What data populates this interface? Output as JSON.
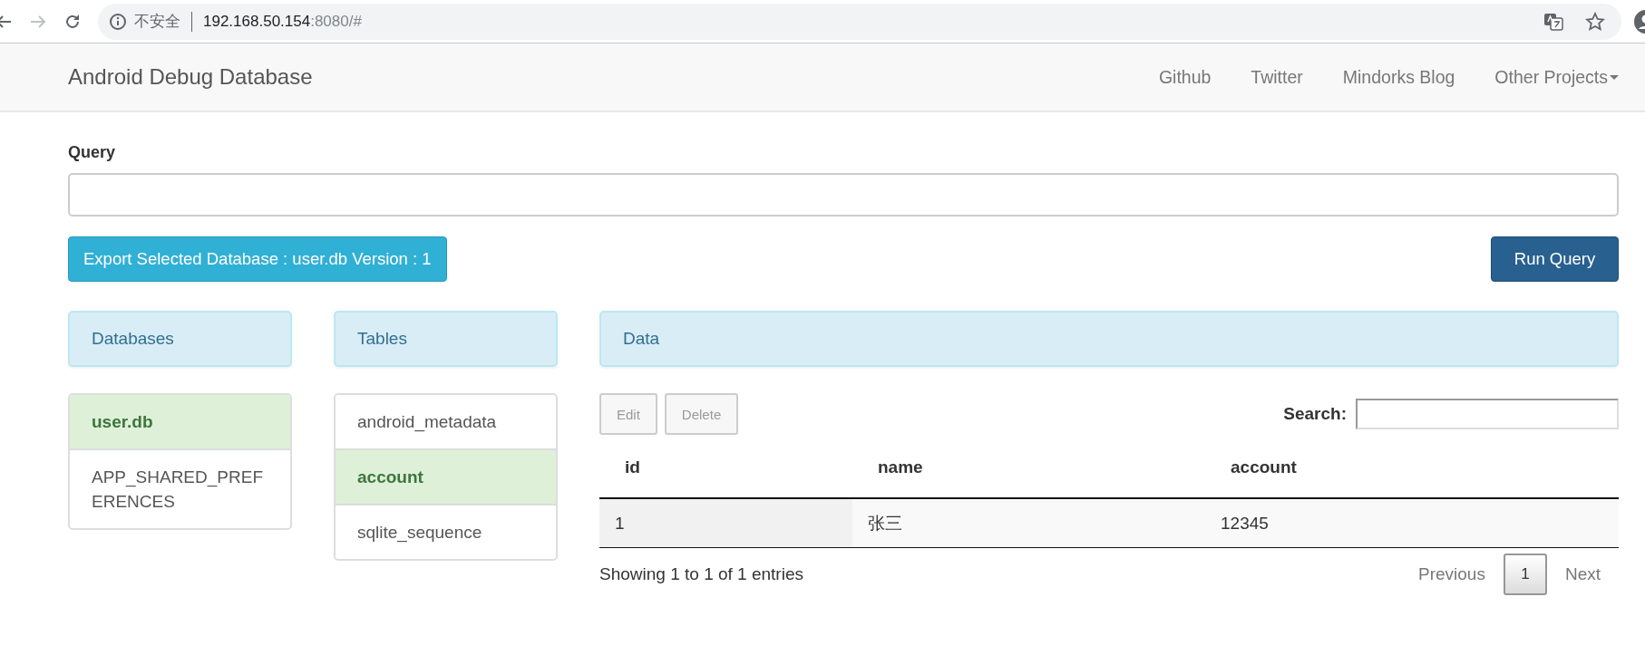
{
  "browser": {
    "security_label": "不安全",
    "url_host": "192.168.50.154",
    "url_rest": ":8080/#"
  },
  "navbar": {
    "brand": "Android Debug Database",
    "links": [
      {
        "label": "Github",
        "dropdown": false
      },
      {
        "label": "Twitter",
        "dropdown": false
      },
      {
        "label": "Mindorks Blog",
        "dropdown": false
      },
      {
        "label": "Other Projects",
        "dropdown": true
      }
    ]
  },
  "query": {
    "label": "Query"
  },
  "export_button": "Export Selected Database : user.db Version : 1",
  "run_button": "Run Query",
  "databases": {
    "heading": "Databases",
    "items": [
      {
        "label": "user.db",
        "selected": true
      },
      {
        "label": "APP_SHARED_PREFERENCES",
        "selected": false
      }
    ]
  },
  "tables": {
    "heading": "Tables",
    "items": [
      {
        "label": "android_metadata",
        "selected": false
      },
      {
        "label": "account",
        "selected": true
      },
      {
        "label": "sqlite_sequence",
        "selected": false
      }
    ]
  },
  "data": {
    "heading": "Data",
    "actions": [
      {
        "label": "Edit",
        "disabled": true
      },
      {
        "label": "Delete",
        "disabled": true
      }
    ],
    "search_label": "Search:",
    "columns": [
      "id",
      "name",
      "account"
    ],
    "rows": [
      [
        "1",
        "张三",
        "12345"
      ]
    ],
    "info": "Showing 1 to 1 of 1 entries",
    "pagination": {
      "previous": "Previous",
      "pages": [
        {
          "label": "1",
          "selected": true
        }
      ],
      "next": "Next"
    }
  }
}
